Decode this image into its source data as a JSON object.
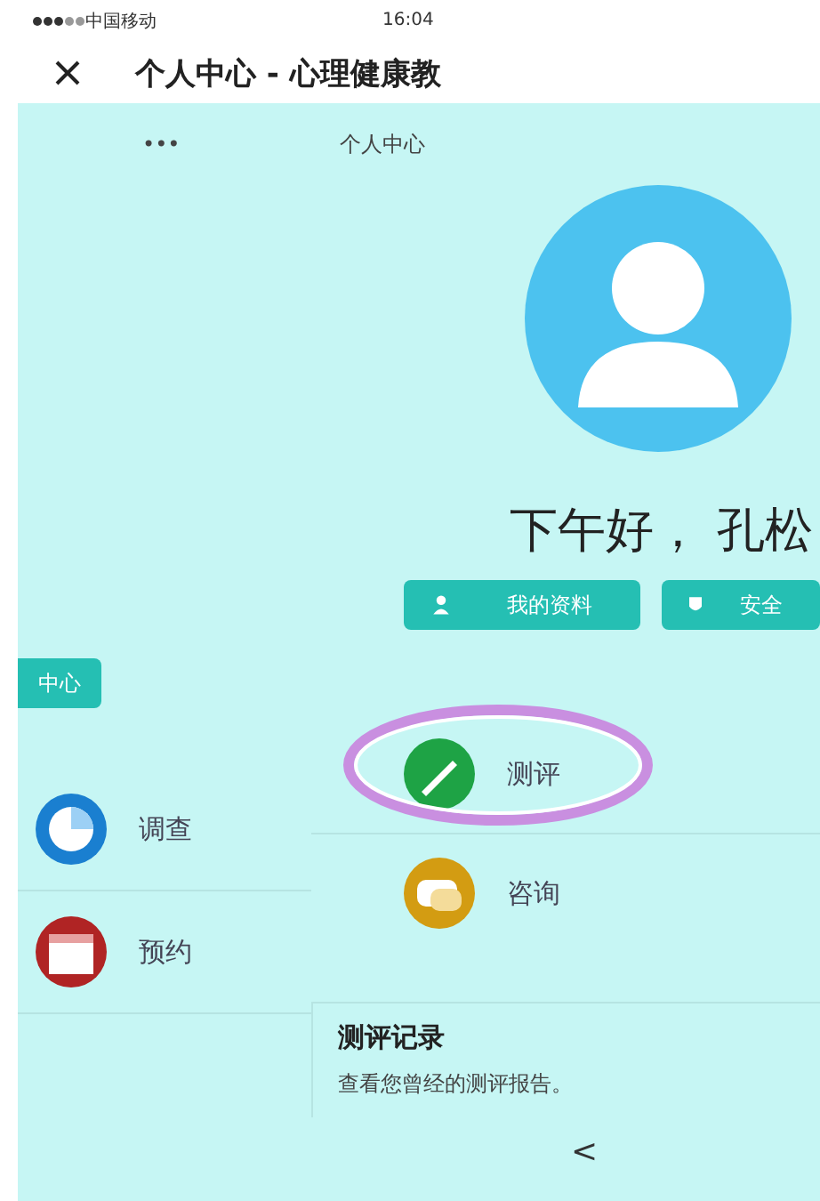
{
  "status_bar": {
    "carrier": "中国移动",
    "time": "16:04"
  },
  "nav": {
    "title": "个人中心 - 心理健康教"
  },
  "sub_bar": {
    "more": "•••",
    "title": "个人中心"
  },
  "greeting": "下午好， 孔松",
  "profile_buttons": [
    {
      "label": "我的资料",
      "kind": "person"
    },
    {
      "label": "安全",
      "kind": "shield"
    }
  ],
  "side_button": "中心",
  "left_menu": [
    {
      "label": "调查",
      "color": "#1a7fd0",
      "kind": "pie"
    },
    {
      "label": "预约",
      "color": "#b02424",
      "kind": "calendar"
    }
  ],
  "right_menu": [
    {
      "label": "测评",
      "color": "#1ea345",
      "kind": "pencil",
      "highlighted": true
    },
    {
      "label": "咨询",
      "color": "#d39c12",
      "kind": "chat",
      "highlighted": false
    }
  ],
  "record_card": {
    "title": "测评记录",
    "description": "查看您曾经的测评报告。"
  },
  "back": "<"
}
